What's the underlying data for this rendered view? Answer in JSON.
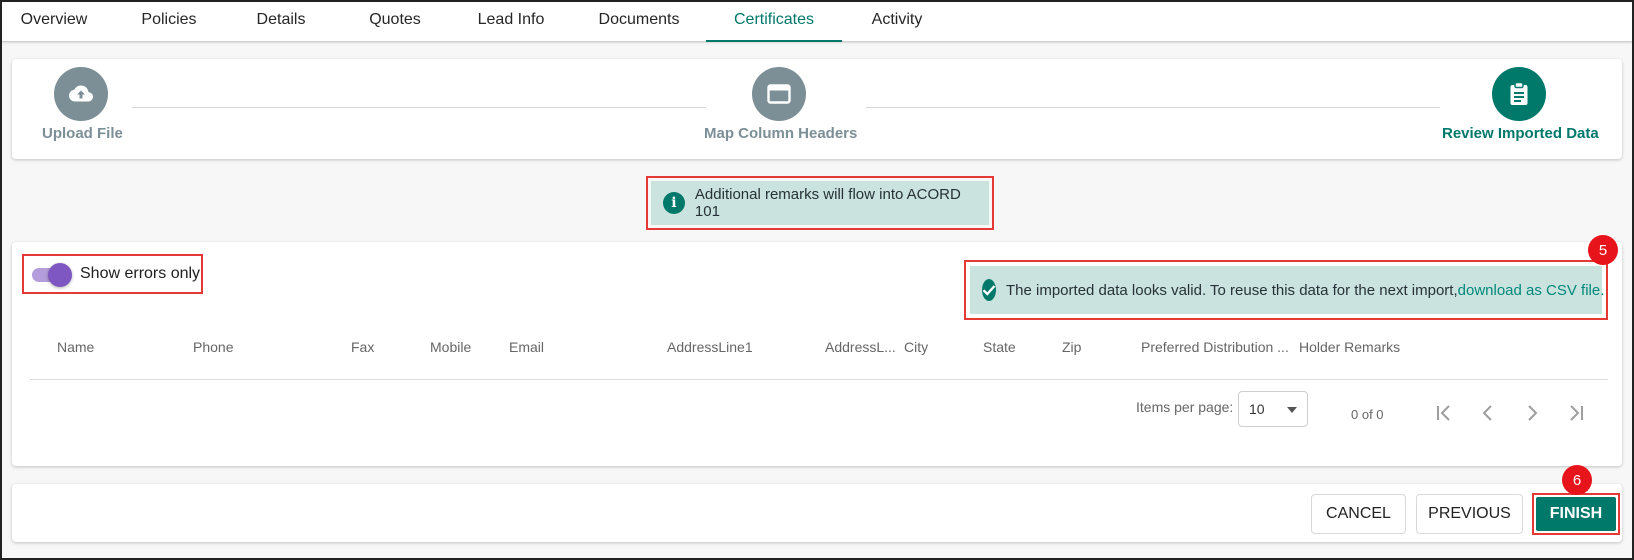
{
  "tabs": [
    "Overview",
    "Policies",
    "Details",
    "Quotes",
    "Lead Info",
    "Documents",
    "Certificates",
    "Activity"
  ],
  "active_tab": "Certificates",
  "stepper": {
    "steps": [
      {
        "label": "Upload File",
        "icon": "cloud-upload-icon",
        "state": "inactive"
      },
      {
        "label": "Map Column Headers",
        "icon": "window-icon",
        "state": "inactive"
      },
      {
        "label": "Review Imported Data",
        "icon": "clipboard-icon",
        "state": "active"
      }
    ]
  },
  "info_banner": {
    "icon": "info-icon",
    "icon_glyph": "i",
    "text": "Additional remarks will flow into ACORD 101"
  },
  "toggle": {
    "label": "Show errors only",
    "checked": true
  },
  "valid_banner": {
    "icon": "check-circle-icon",
    "text": "The imported data looks valid. To reuse this data for the next import,",
    "link_text": "download as CSV file."
  },
  "annotations": {
    "badge_1": "5",
    "badge_2": "6"
  },
  "table": {
    "columns": [
      "Name",
      "Phone",
      "Fax",
      "Mobile",
      "Email",
      "AddressLine1",
      "AddressL...",
      "City",
      "State",
      "Zip",
      "Preferred Distribution ...",
      "Holder Remarks"
    ],
    "rows": []
  },
  "paginator": {
    "items_per_page_label": "Items per page:",
    "items_per_page": "10",
    "range_label": "0 of 0"
  },
  "footer": {
    "cancel": "CANCEL",
    "previous": "PREVIOUS",
    "finish": "FINISH"
  },
  "colors": {
    "accent": "#00796b",
    "inactive": "#7c8f96",
    "banner_bg": "#cbe3df",
    "toggle": "#7e57c2",
    "annotation_red": "#e53935"
  }
}
